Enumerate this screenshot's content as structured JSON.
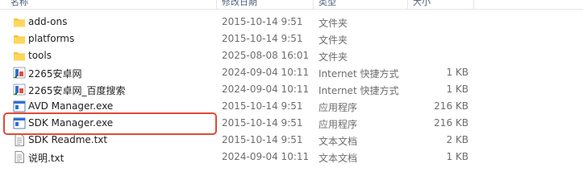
{
  "columns": {
    "name": "名称",
    "date": "修改日期",
    "type": "类型",
    "size": "大小"
  },
  "files": [
    {
      "name": "add-ons",
      "date": "2015-10-14 9:51",
      "type": "文件夹",
      "size": "",
      "icon": "folder-icon"
    },
    {
      "name": "platforms",
      "date": "2015-10-14 9:51",
      "type": "文件夹",
      "size": "",
      "icon": "folder-icon"
    },
    {
      "name": "tools",
      "date": "2025-08-08 16:01",
      "type": "文件夹",
      "size": "",
      "icon": "folder-icon"
    },
    {
      "name": "2265安卓网",
      "date": "2024-09-04 10:11",
      "type": "Internet 快捷方式",
      "size": "1 KB",
      "icon": "internet-shortcut-icon"
    },
    {
      "name": "2265安卓网_百度搜索",
      "date": "2024-09-04 10:11",
      "type": "Internet 快捷方式",
      "size": "1 KB",
      "icon": "internet-shortcut-icon"
    },
    {
      "name": "AVD Manager.exe",
      "date": "2015-10-14 9:51",
      "type": "应用程序",
      "size": "216 KB",
      "icon": "application-icon"
    },
    {
      "name": "SDK Manager.exe",
      "date": "2015-10-14 9:51",
      "type": "应用程序",
      "size": "216 KB",
      "icon": "application-icon"
    },
    {
      "name": "SDK Readme.txt",
      "date": "2015-10-14 9:51",
      "type": "文本文档",
      "size": "2 KB",
      "icon": "text-file-icon"
    },
    {
      "name": "说明.txt",
      "date": "2024-09-04 10:11",
      "type": "文本文档",
      "size": "1 KB",
      "icon": "text-file-icon"
    }
  ],
  "highlight_color": "#e04a33",
  "folder_color": "#f4c442"
}
